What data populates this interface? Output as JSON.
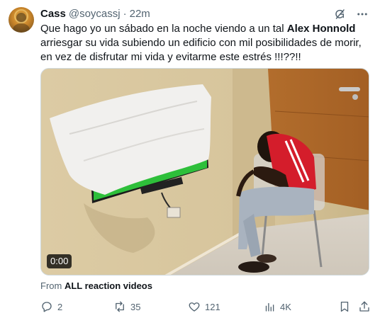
{
  "author": {
    "name": "Cass",
    "handle": "@soycassj",
    "separator": "·",
    "time": "22m"
  },
  "tweet": {
    "text_before": "Que hago yo un sábado en la noche viendo a un tal ",
    "text_bold": "Alex Honnold",
    "text_after": " arriesgar su vida subiendo un edificio con mil posibilidades de morir, en vez de disfrutar mi vida y evitarme este estrés !!!??!!"
  },
  "media": {
    "duration": "0:00"
  },
  "source": {
    "prefix": "From",
    "name": "ALL reaction videos"
  },
  "actions": {
    "replies": "2",
    "reposts": "35",
    "likes": "121",
    "views": "4K"
  },
  "icons": {
    "header": [
      "grok-icon",
      "more-icon"
    ],
    "actions": [
      "reply-icon",
      "repost-icon",
      "like-icon",
      "views-icon",
      "bookmark-icon",
      "share-icon"
    ]
  },
  "colors": {
    "text": "#0f1419",
    "secondary": "#536471",
    "border": "#cfd9de"
  }
}
